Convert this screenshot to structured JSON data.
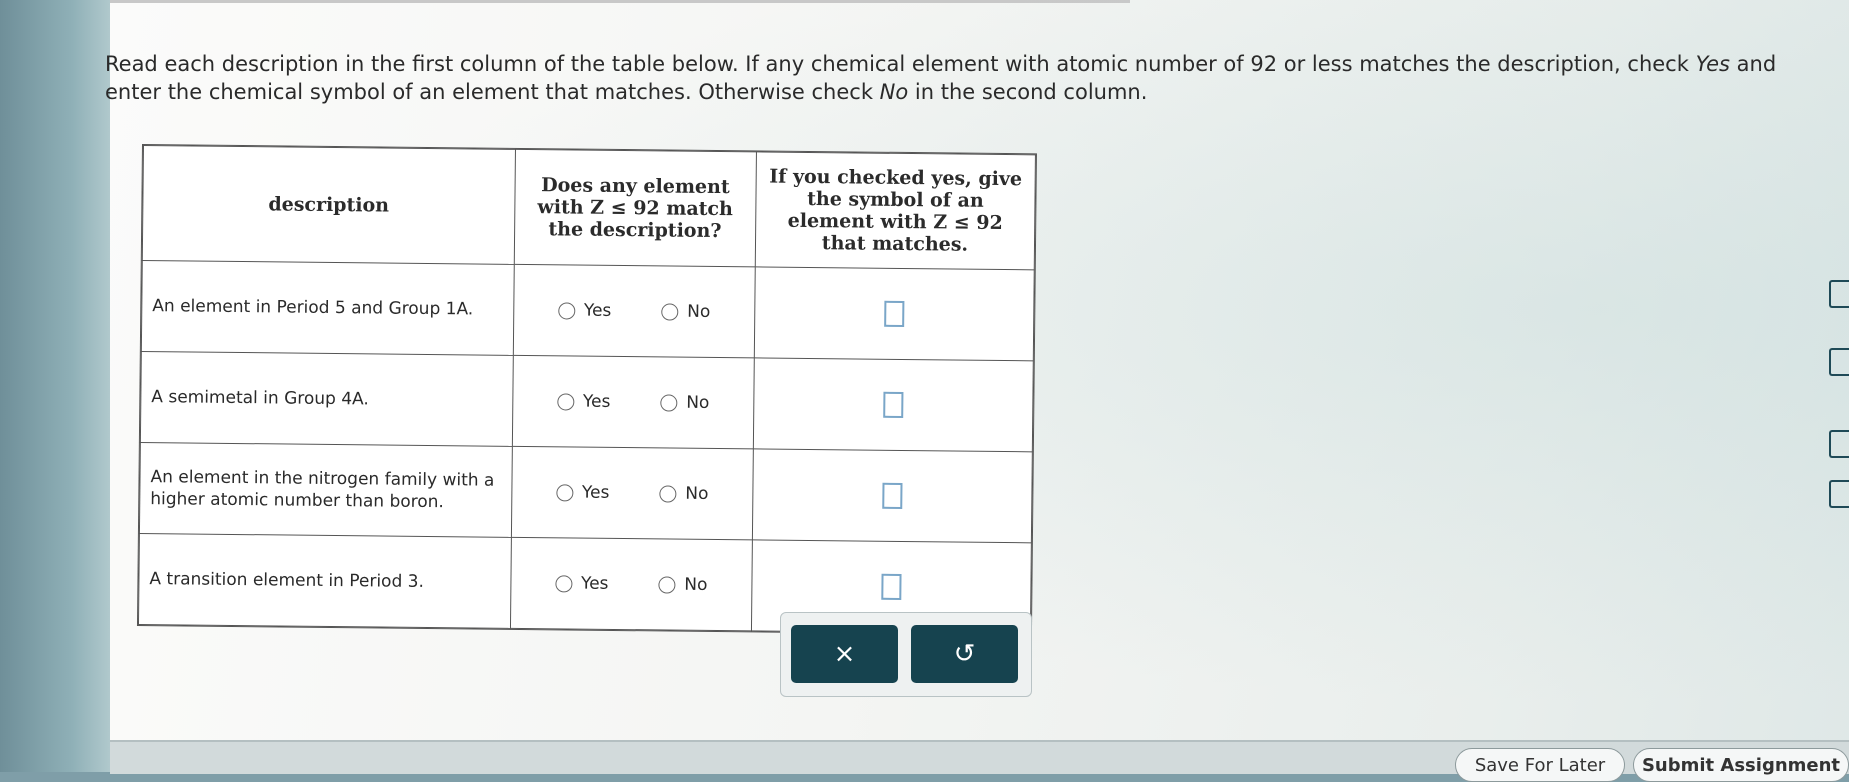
{
  "instructions": {
    "part1": "Read each description in the first column of the table below. If any chemical element with atomic number of 92 or less matches the description, check ",
    "yes_word": "Yes",
    "part2": " and enter the chemical symbol of an element that matches. Otherwise check ",
    "no_word": "No",
    "part3": " in the second column."
  },
  "table": {
    "headers": {
      "description": "description",
      "match": "Does any element with Z ≤ 92 match the description?",
      "symbol": "If you checked yes, give the symbol of an element with Z ≤ 92 that matches."
    },
    "rows": [
      {
        "description": "An element in Period 5 and Group 1A.",
        "yes": "Yes",
        "no": "No"
      },
      {
        "description": "A semimetal in Group 4A.",
        "yes": "Yes",
        "no": "No"
      },
      {
        "description": "An element in the nitrogen family with a higher atomic number than boron.",
        "yes": "Yes",
        "no": "No"
      },
      {
        "description": "A transition element in Period 3.",
        "yes": "Yes",
        "no": "No"
      }
    ]
  },
  "tools": {
    "clear_symbol": "×",
    "undo_symbol": "↺"
  },
  "footer": {
    "save_label": "Save For Later",
    "submit_label": "Submit Assignment"
  },
  "colors": {
    "tool_button_bg": "#16434f",
    "answer_box_border": "#7aa6c8"
  }
}
